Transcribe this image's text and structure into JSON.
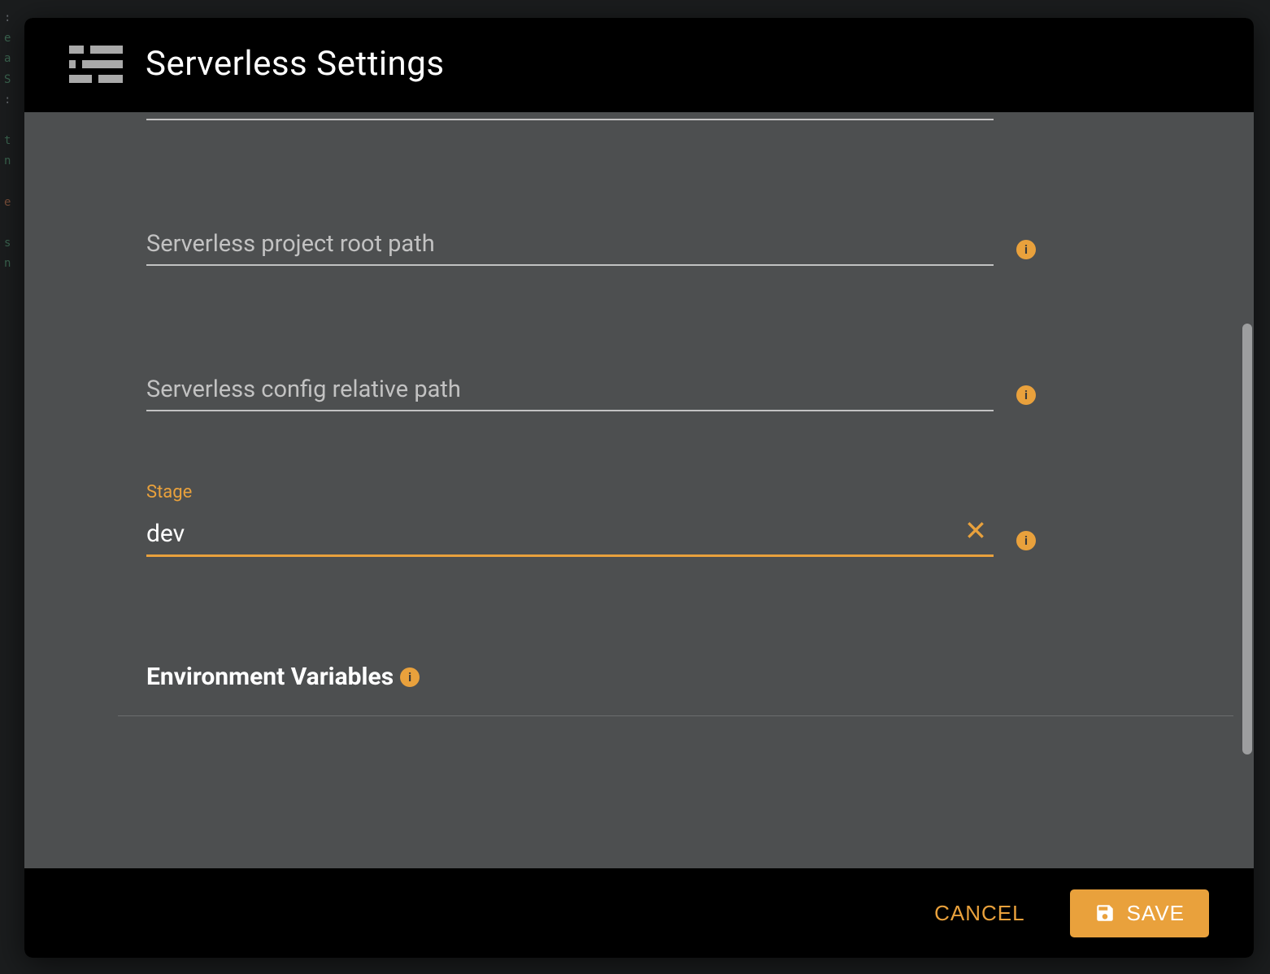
{
  "dialog": {
    "title": "Serverless Settings",
    "fields": {
      "root_path": {
        "placeholder": "Serverless project root path",
        "value": ""
      },
      "config_path": {
        "placeholder": "Serverless config relative path",
        "value": ""
      },
      "stage": {
        "label": "Stage",
        "value": "dev"
      }
    },
    "section": {
      "env_vars_heading": "Environment Variables"
    },
    "footer": {
      "cancel": "CANCEL",
      "save": "SAVE"
    }
  },
  "background_code_fragments": [
    ":",
    "e",
    "a",
    "S",
    ":",
    "t",
    "n",
    "e",
    "s",
    "n"
  ],
  "colors": {
    "accent": "#e9a13c",
    "dialog_bg": "#4d4f50",
    "header_footer_bg": "#000000"
  }
}
